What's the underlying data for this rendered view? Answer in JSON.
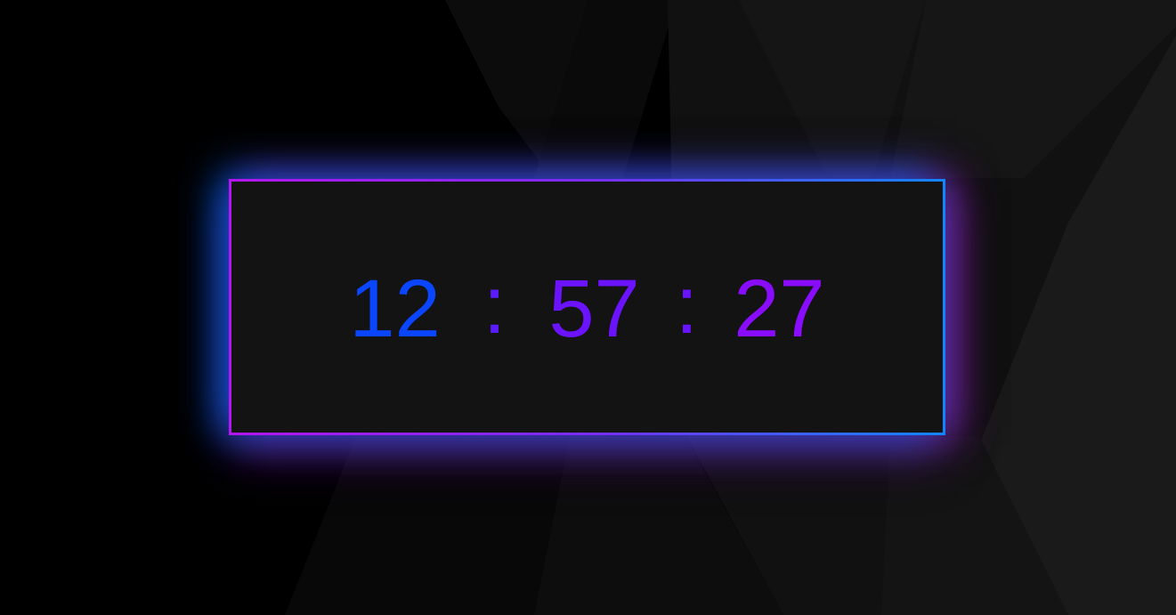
{
  "clock": {
    "hours": "12",
    "separator_1": ":",
    "minutes": "57",
    "separator_2": ":",
    "seconds": "27"
  },
  "colors": {
    "background": "#000000",
    "panel": "#131313",
    "hours_text": "#0a45ff",
    "minutes_text": "#6b12ff",
    "seconds_text": "#8a0cff",
    "border_gradient_start": "#b316f0",
    "border_gradient_mid": "#7a2cf5",
    "border_gradient_end": "#1185ff",
    "glow_blue": "#006eff",
    "glow_purple": "#821ea0"
  }
}
